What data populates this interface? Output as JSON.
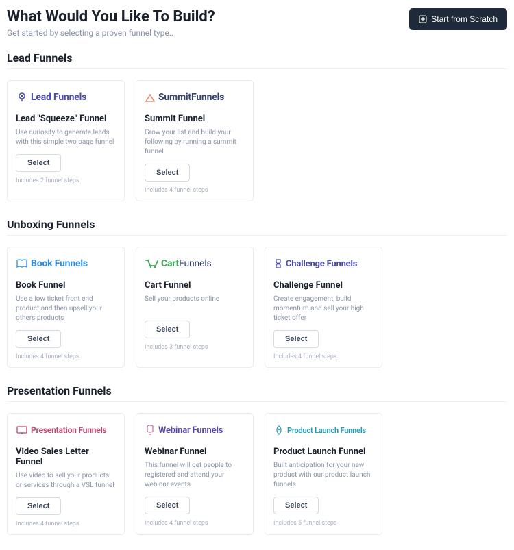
{
  "header": {
    "title": "What Would You Like To Build?",
    "subtitle": "Get started by selecting a proven funnel type..",
    "scratch_label": "Start from Scratch"
  },
  "sections": {
    "lead": {
      "title": "Lead Funnels",
      "cards": [
        {
          "logo_label": "Lead Funnels",
          "name": "Lead \"Squeeze\" Funnel",
          "desc": "Use curiosity to generate leads with this simple two page funnel",
          "select": "Select",
          "meta": "Includes 2 funnel steps"
        },
        {
          "logo_label": "SummitFunnels",
          "name": "Summit Funnel",
          "desc": "Grow your list and build your following by running a summit funnel",
          "select": "Select",
          "meta": "Includes 4 funnel steps"
        }
      ]
    },
    "unboxing": {
      "title": "Unboxing Funnels",
      "cards": [
        {
          "logo_label": "Book Funnels",
          "name": "Book Funnel",
          "desc": "Use a low ticket front end product and then upsell your others products",
          "select": "Select",
          "meta": "Includes 4 funnel steps"
        },
        {
          "logo1": "Cart",
          "logo2": "Funnels",
          "name": "Cart Funnel",
          "desc": "Sell your products online",
          "select": "Select",
          "meta": "Includes 3 funnel steps"
        },
        {
          "logo_label": "Challenge Funnels",
          "name": "Challenge Funnel",
          "desc": "Create engagement, build momentum and sell your high ticket offer",
          "select": "Select",
          "meta": "Includes 4 funnel steps"
        }
      ]
    },
    "presentation": {
      "title": "Presentation Funnels",
      "cards": [
        {
          "logo_label": "Presentation Funnels",
          "name": "Video Sales Letter Funnel",
          "desc": "Use video to sell your products or services through a VSL funnel",
          "select": "Select",
          "meta": "Includes 4 funnel steps"
        },
        {
          "logo_label": "Webinar Funnels",
          "name": "Webinar Funnel",
          "desc": "This funnel will get people to registered and attend your webinar events",
          "select": "Select",
          "meta": "Includes 4 funnel steps"
        },
        {
          "logo_label": "Product Launch Funnels",
          "name": "Product Launch Funnel",
          "desc": "Built anticipation for your new product with our product launch funnels",
          "select": "Select",
          "meta": "Includes 5 funnel steps"
        }
      ]
    }
  }
}
